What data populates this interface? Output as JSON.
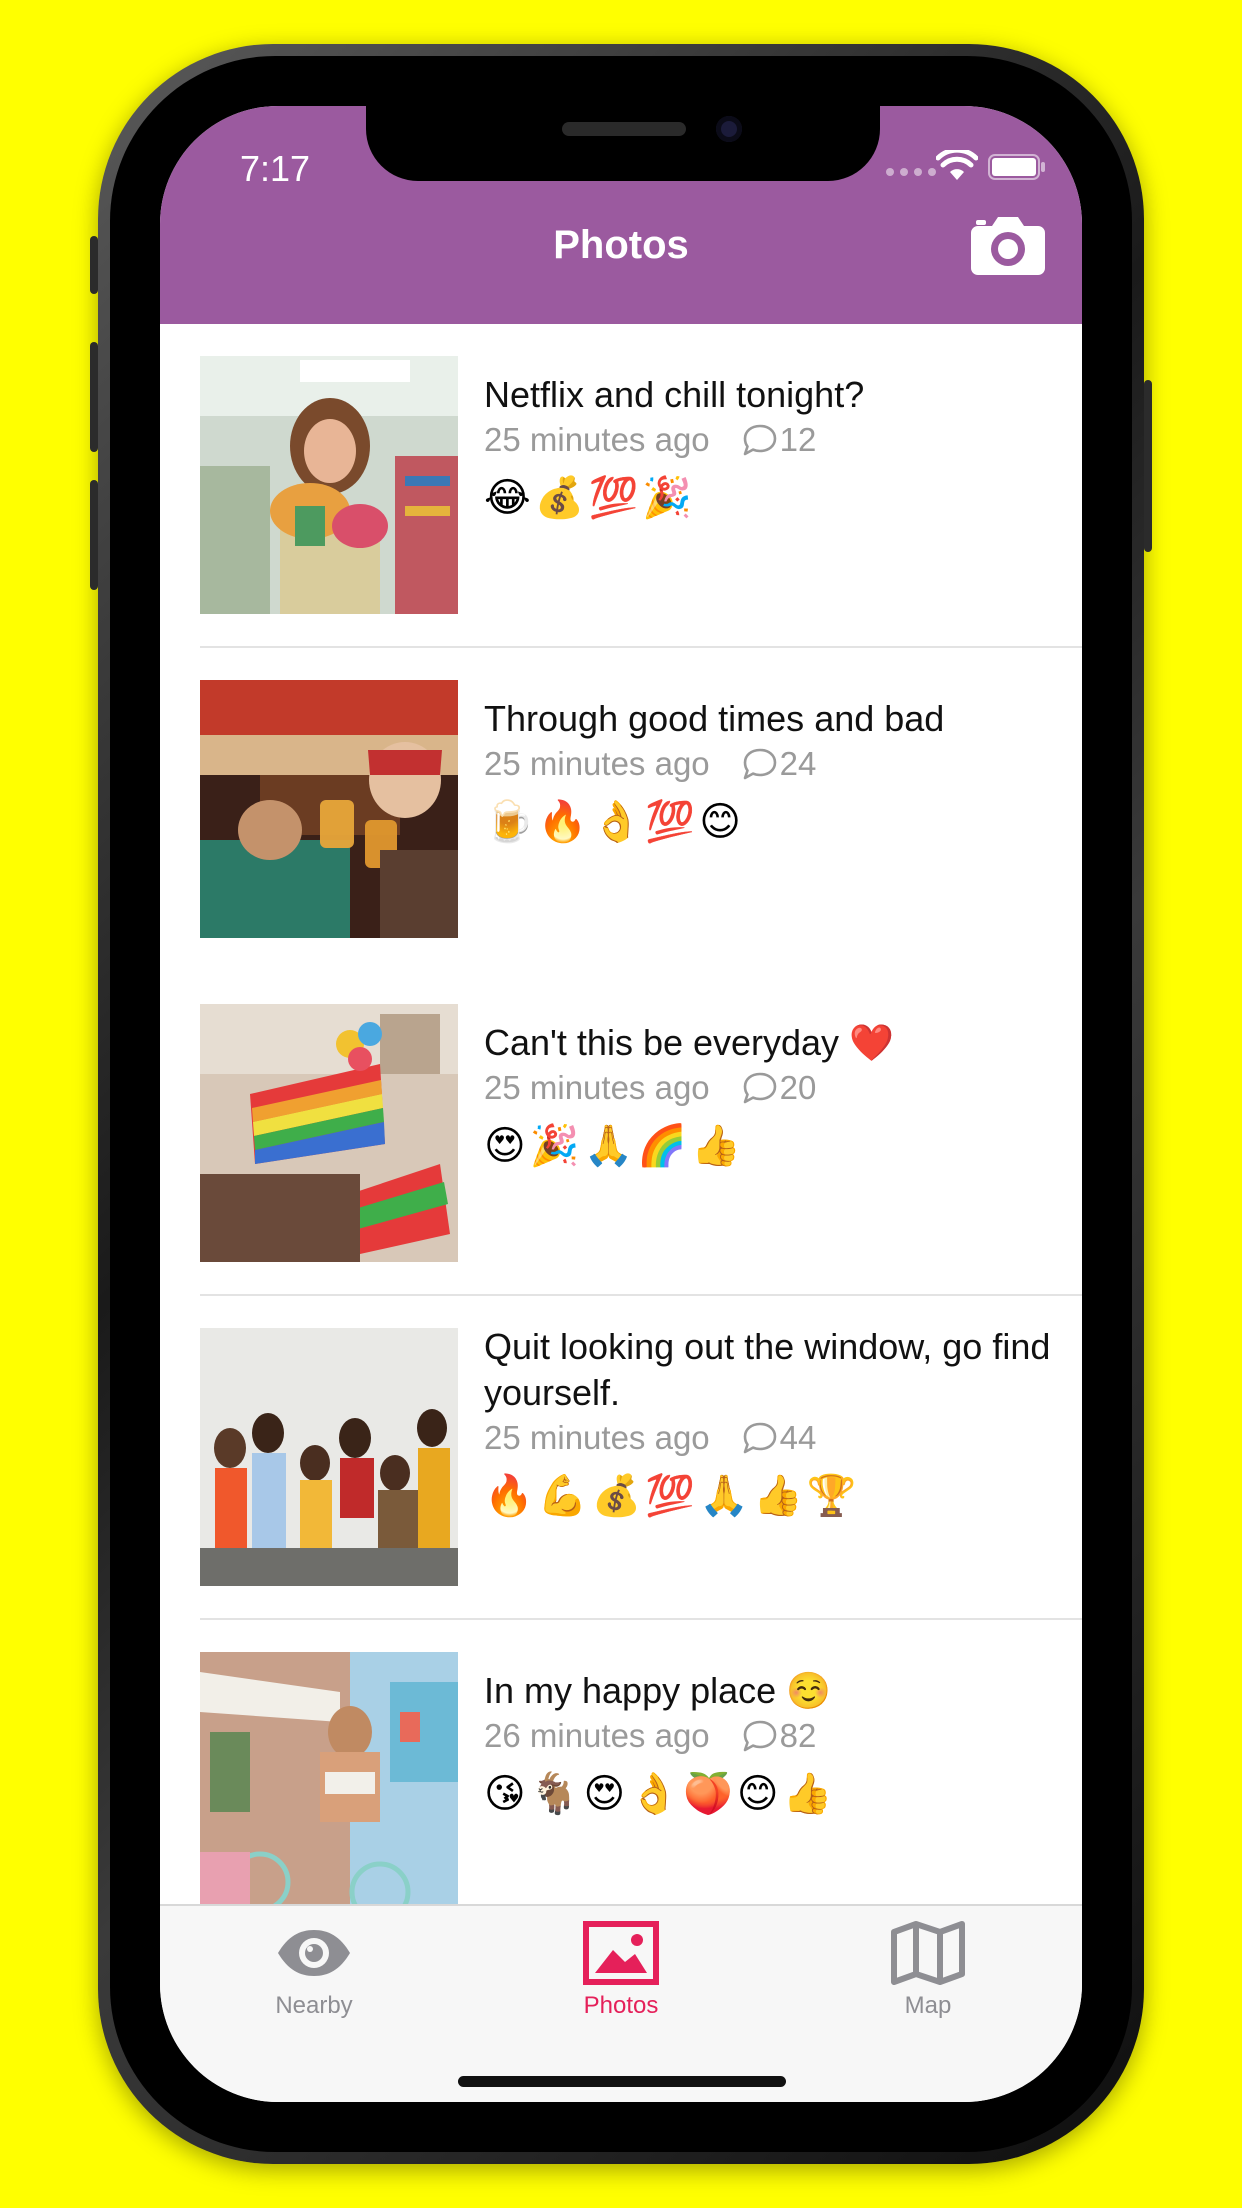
{
  "status_bar": {
    "time": "7:17"
  },
  "header": {
    "title": "Photos",
    "background": "#9B5A9F",
    "camera_icon": "camera-icon"
  },
  "posts": [
    {
      "title": "Netflix and chill tonight?",
      "time": "25 minutes ago",
      "comments": "12",
      "emojis": "😂💰💯🎉"
    },
    {
      "title": "Through good times and bad",
      "time": "25 minutes ago",
      "comments": "24",
      "emojis": "🍺🔥👌💯😊"
    },
    {
      "title": "Can't this be everyday ❤️",
      "time": "25 minutes ago",
      "comments": "20",
      "emojis": "😍🎉🙏🌈👍"
    },
    {
      "title": "Quit looking out the window, go find yourself.",
      "time": "25 minutes ago",
      "comments": "44",
      "emojis": "🔥💪💰💯🙏👍🏆"
    },
    {
      "title": "In my happy place ☺️",
      "time": "26 minutes ago",
      "comments": "82",
      "emojis": "😘🐐😍👌🍑😊👍"
    }
  ],
  "tabbar": {
    "tabs": [
      {
        "label": "Nearby",
        "icon": "eye-icon",
        "active": false
      },
      {
        "label": "Photos",
        "icon": "photo-icon",
        "active": true
      },
      {
        "label": "Map",
        "icon": "map-icon",
        "active": false
      }
    ],
    "active_color": "#E5205A",
    "inactive_color": "#8E8E93"
  }
}
